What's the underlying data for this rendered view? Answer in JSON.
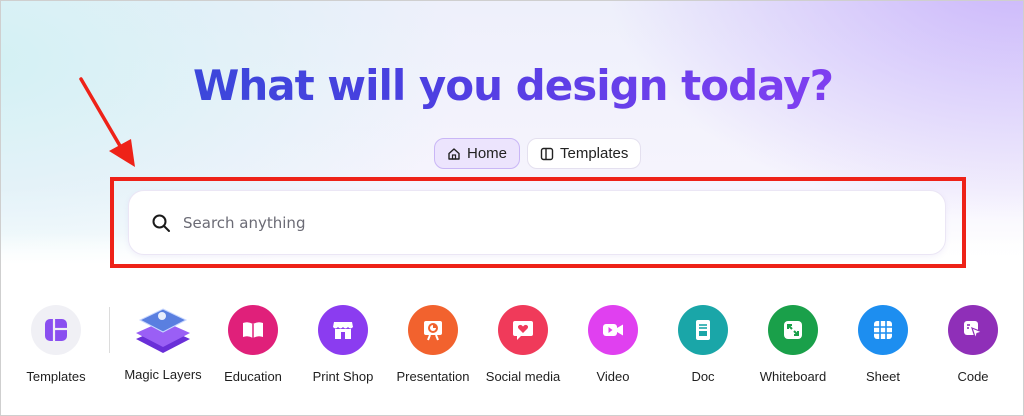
{
  "headline": "What will you design today?",
  "tabs": [
    {
      "label": "Home",
      "active": true,
      "icon": "home-icon"
    },
    {
      "label": "Templates",
      "active": false,
      "icon": "template-icon"
    }
  ],
  "search": {
    "placeholder": "Search anything",
    "value": ""
  },
  "shortcuts": [
    {
      "label": "Templates",
      "icon": "templates-icon",
      "color": "#f0f0f5"
    },
    {
      "label": "Magic Layers",
      "icon": "magic-layers-icon",
      "color": "#8a4ff0"
    },
    {
      "label": "Education",
      "icon": "book-icon",
      "color": "#e0207a"
    },
    {
      "label": "Print Shop",
      "icon": "storefront-icon",
      "color": "#8b3cf0"
    },
    {
      "label": "Presentation",
      "icon": "presentation-icon",
      "color": "#f2622e"
    },
    {
      "label": "Social media",
      "icon": "heart-chat-icon",
      "color": "#f03a5a"
    },
    {
      "label": "Video",
      "icon": "video-camera-icon",
      "color": "#e040f0"
    },
    {
      "label": "Doc",
      "icon": "doc-icon",
      "color": "#1aa6a8"
    },
    {
      "label": "Whiteboard",
      "icon": "expand-icon",
      "color": "#1aa04a"
    },
    {
      "label": "Sheet",
      "icon": "table-icon",
      "color": "#1d8ef0"
    },
    {
      "label": "Code",
      "icon": "code-cursor-icon",
      "color": "#8f2fb8"
    }
  ],
  "colors": {
    "annotation": "#ee2218",
    "headline_start": "#2f4fd6",
    "headline_end": "#8a3ff0",
    "active_tab": "#ece4fd"
  }
}
